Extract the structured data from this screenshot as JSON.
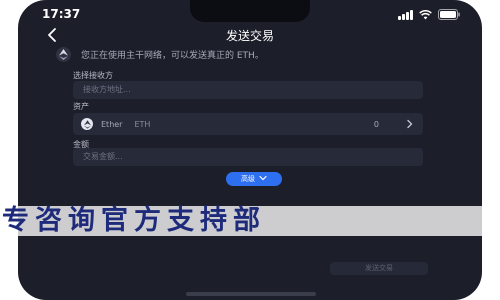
{
  "status_bar": {
    "time": "17:37"
  },
  "header": {
    "back_icon": "chevron-left-icon",
    "title": "发送交易"
  },
  "notice": {
    "icon": "ethereum-icon",
    "text": "您正在使用主干网络，可以发送真正的 ETH。"
  },
  "recipient": {
    "label": "选择接收方",
    "placeholder": "接收方地址..."
  },
  "asset": {
    "label": "资产",
    "icon": "ethereum-icon",
    "name": "Ether",
    "symbol": "ETH",
    "balance": "0",
    "chevron": "chevron-right-icon"
  },
  "amount": {
    "label": "金额",
    "placeholder": "交易金额..."
  },
  "advanced": {
    "label": "高级",
    "icon": "chevron-down-icon"
  },
  "watermark": {
    "text": "专咨询官方支持部"
  },
  "send_button": {
    "label": "发送交易"
  },
  "colors": {
    "background": "#1c1f2a",
    "field": "#272a38",
    "accent": "#2e6ff0",
    "watermark": "#1e2a7a"
  }
}
